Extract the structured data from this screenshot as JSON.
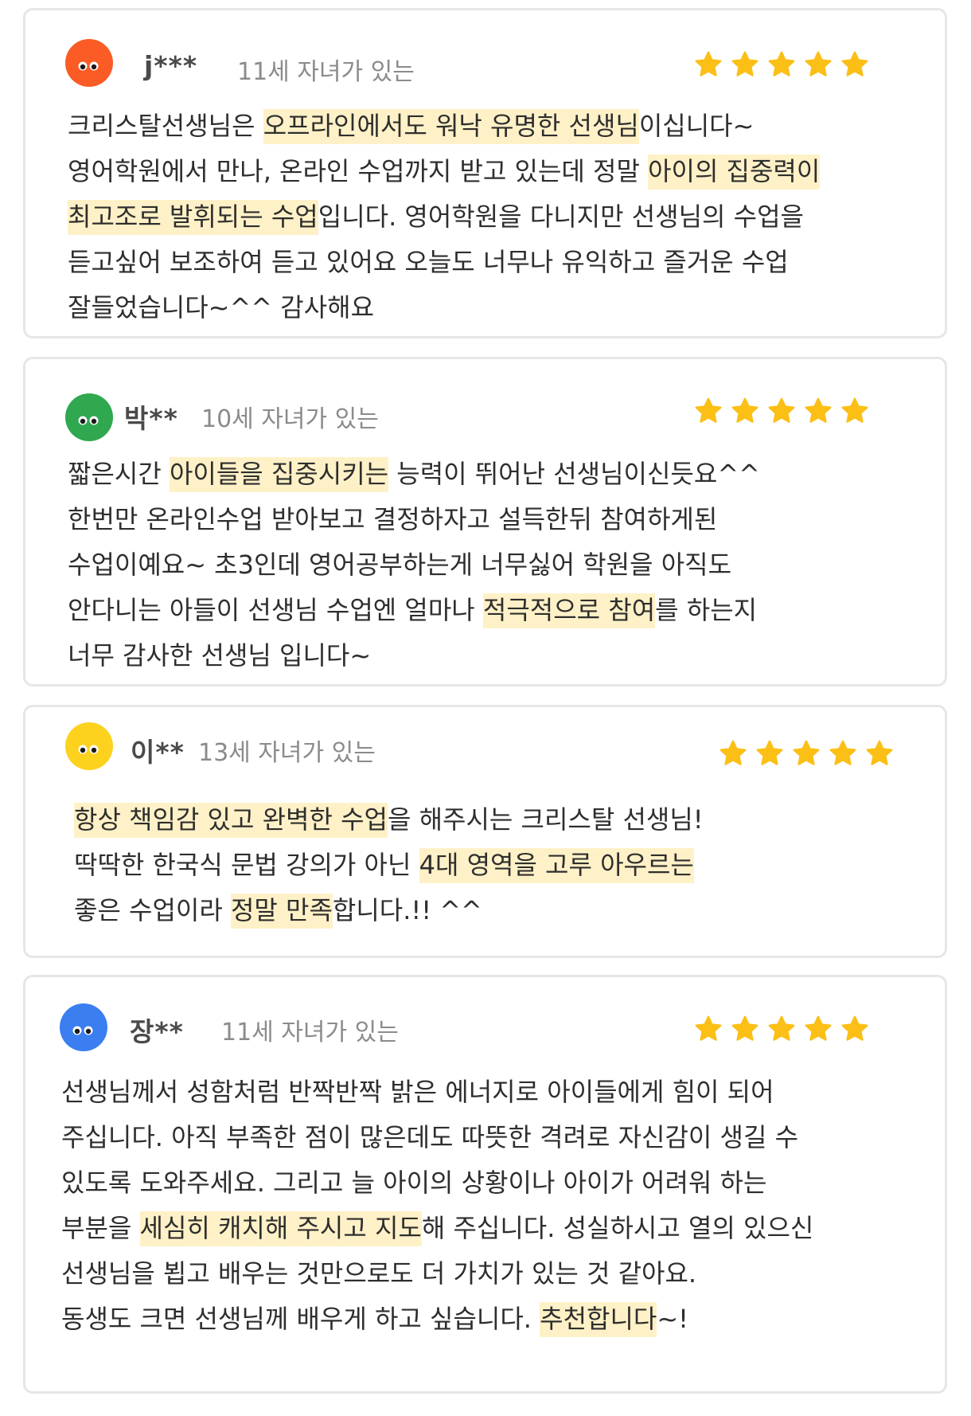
{
  "reviews": [
    {
      "avatar_color": "#fb5b25",
      "avatar_icon": "orange-face-avatar",
      "nickname": "j***",
      "age_label": "11세 자녀가 있는",
      "rating": 5,
      "lines": [
        [
          {
            "t": "크리스탈선생님은 ",
            "hl": false
          },
          {
            "t": "오프라인에서도 워낙 유명한 선생님",
            "hl": true
          },
          {
            "t": "이십니다~",
            "hl": false
          }
        ],
        [
          {
            "t": "영어학원에서 만나, 온라인 수업까지 받고 있는데 정말 ",
            "hl": false
          },
          {
            "t": "아이의 집중력이",
            "hl": true
          }
        ],
        [
          {
            "t": "최고조로 발휘되는 수업",
            "hl": true
          },
          {
            "t": "입니다. 영어학원을 다니지만 선생님의 수업을",
            "hl": false
          }
        ],
        [
          {
            "t": "듣고싶어 보조하여 듣고 있어요 오늘도 너무나 유익하고 즐거운 수업",
            "hl": false
          }
        ],
        [
          {
            "t": "잘들었습니다~^^ 감사해요",
            "hl": false
          }
        ]
      ]
    },
    {
      "avatar_color": "#2fa84f",
      "avatar_icon": "green-face-avatar",
      "nickname": "박**",
      "age_label": "10세 자녀가 있는",
      "rating": 5,
      "lines": [
        [
          {
            "t": "짧은시간 ",
            "hl": false
          },
          {
            "t": "아이들을 집중시키는",
            "hl": true
          },
          {
            "t": " 능력이 뛰어난 선생님이신듯요^^",
            "hl": false
          }
        ],
        [
          {
            "t": "한번만 온라인수업 받아보고 결정하자고 설득한뒤 참여하게된",
            "hl": false
          }
        ],
        [
          {
            "t": "수업이예요~ 초3인데 영어공부하는게 너무싫어 학원을 아직도",
            "hl": false
          }
        ],
        [
          {
            "t": "안다니는 아들이 선생님 수업엔 얼마나 ",
            "hl": false
          },
          {
            "t": "적극적으로 참여",
            "hl": true
          },
          {
            "t": "를 하는지",
            "hl": false
          }
        ],
        [
          {
            "t": "너무 감사한 선생님 입니다~",
            "hl": false
          }
        ]
      ]
    },
    {
      "avatar_color": "#fcd21e",
      "avatar_icon": "yellow-face-avatar",
      "nickname": "이**",
      "age_label": "13세 자녀가 있는",
      "rating": 5,
      "lines": [
        [
          {
            "t": "항상 책임감 있고 완벽한 수업",
            "hl": true
          },
          {
            "t": "을 해주시는 크리스탈 선생님!",
            "hl": false
          }
        ],
        [
          {
            "t": "딱딱한 한국식 문법 강의가 아닌 ",
            "hl": false
          },
          {
            "t": "4대 영역을 고루 아우르는",
            "hl": true
          }
        ],
        [
          {
            "t": "좋은 수업이라 ",
            "hl": false
          },
          {
            "t": "정말 만족",
            "hl": true
          },
          {
            "t": "합니다.!! ^^",
            "hl": false
          }
        ]
      ]
    },
    {
      "avatar_color": "#3a7ef0",
      "avatar_icon": "blue-face-avatar",
      "nickname": "장**",
      "age_label": "11세 자녀가 있는",
      "rating": 5,
      "lines": [
        [
          {
            "t": "선생님께서 성함처럼 반짝반짝 밝은 에너지로 아이들에게 힘이 되어",
            "hl": false
          }
        ],
        [
          {
            "t": "주십니다. 아직 부족한 점이 많은데도 따뜻한 격려로 자신감이 생길 수",
            "hl": false
          }
        ],
        [
          {
            "t": "있도록 도와주세요. 그리고 늘 아이의 상황이나 아이가 어려워 하는",
            "hl": false
          }
        ],
        [
          {
            "t": "부분을 ",
            "hl": false
          },
          {
            "t": "세심히 캐치해 주시고 지도",
            "hl": true
          },
          {
            "t": "해 주십니다. 성실하시고 열의 있으신",
            "hl": false
          }
        ],
        [
          {
            "t": "선생님을 뵙고 배우는 것만으로도 더 가치가 있는 것 같아요.",
            "hl": false
          }
        ],
        [
          {
            "t": "동생도 크면 선생님께 배우게 하고 싶습니다. ",
            "hl": false
          },
          {
            "t": "추천합니다",
            "hl": true
          },
          {
            "t": "~!",
            "hl": false
          }
        ]
      ]
    }
  ],
  "colors": {
    "star": "#fbbf16",
    "highlight": "#fff1c7",
    "card_border": "#e6e6e6"
  }
}
